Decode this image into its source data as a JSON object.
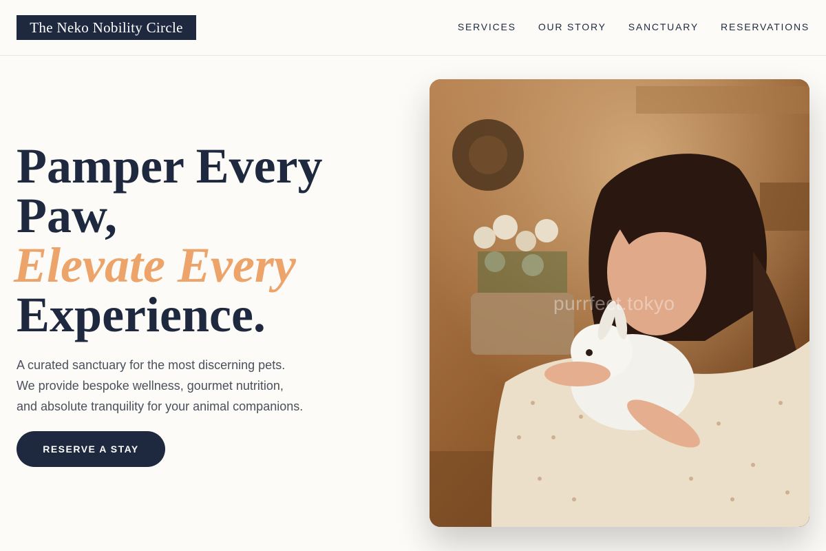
{
  "header": {
    "logo_text": "The Neko Nobility Circle",
    "nav": [
      "SERVICES",
      "OUR STORY",
      "SANCTUARY",
      "RESERVATIONS"
    ]
  },
  "hero": {
    "headline_line1": "Pamper Every",
    "headline_line2": "Paw,",
    "headline_accent": "Elevate Every",
    "headline_line4": "Experience.",
    "description_lines": [
      "A curated sanctuary for the most discerning pets.",
      "We provide bespoke wellness, gourmet nutrition,",
      "and absolute tranquility for your animal companions."
    ],
    "cta_label": "RESERVE A STAY",
    "image_watermark": "purrfect.tokyo"
  },
  "colors": {
    "navy": "#1e2940",
    "accent": "#eda46a",
    "background": "#fcfbf7",
    "body_text": "#4a505c"
  }
}
